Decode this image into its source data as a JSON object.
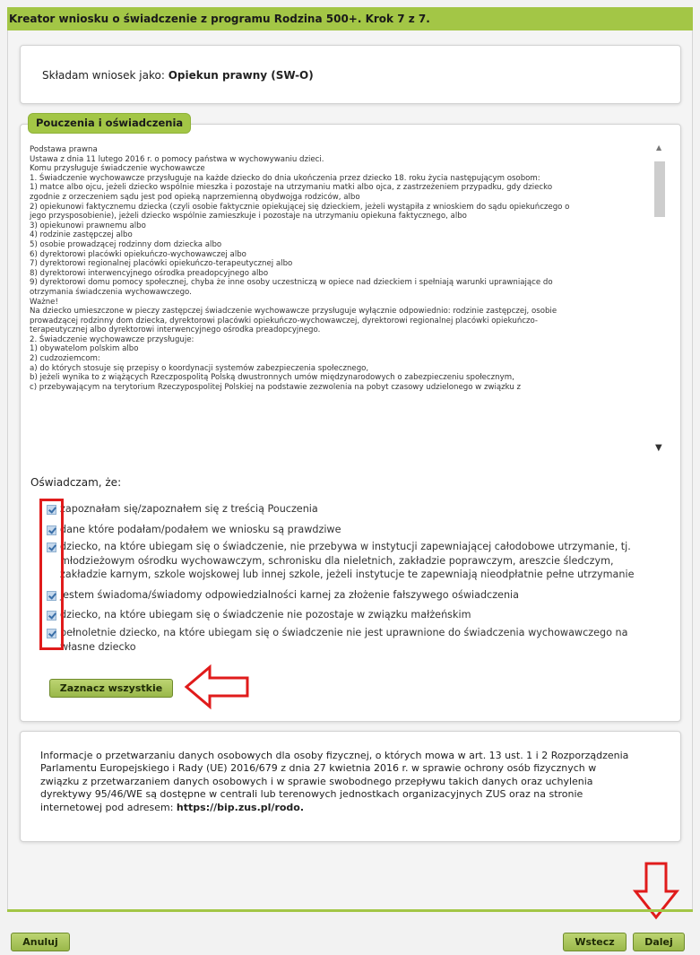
{
  "window": {
    "title": "Kreator wniosku o świadczenie z programu Rodzina 500+. Krok 7 z 7."
  },
  "applicant": {
    "prefix": "Składam wniosek jako:",
    "role": "Opiekun prawny (SW-O)"
  },
  "instructions": {
    "title": "Pouczenia i oświadczenia",
    "lines": [
      "Podstawa prawna",
      "Ustawa z dnia 11 lutego 2016 r. o pomocy państwa w wychowywaniu dzieci.",
      "Komu przysługuje świadczenie wychowawcze",
      "1. Świadczenie wychowawcze przysługuje na każde dziecko do dnia ukończenia przez dziecko 18. roku życia następującym osobom:",
      "1) matce albo ojcu, jeżeli dziecko wspólnie mieszka i pozostaje na utrzymaniu matki albo ojca, z zastrzeżeniem przypadku, gdy dziecko",
      "zgodnie z orzeczeniem sądu jest pod opieką naprzemienną obydwojga rodziców, albo",
      "2) opiekunowi faktycznemu dziecka (czyli osobie faktycznie opiekującej się dzieckiem, jeżeli wystąpiła z wnioskiem do sądu opiekuńczego o",
      "jego przysposobienie), jeżeli dziecko wspólnie zamieszkuje i pozostaje na utrzymaniu opiekuna faktycznego, albo",
      "3) opiekunowi prawnemu albo",
      "4) rodzinie zastępczej albo",
      "5) osobie prowadzącej rodzinny dom dziecka albo",
      "6) dyrektorowi placówki opiekuńczo-wychowawczej albo",
      "7) dyrektorowi regionalnej placówki opiekuńczo-terapeutycznej albo",
      "8) dyrektorowi interwencyjnego ośrodka preadopcyjnego albo",
      "9) dyrektorowi domu pomocy społecznej, chyba że inne osoby uczestniczą w opiece nad dzieckiem i spełniają warunki uprawniające do",
      "otrzymania świadczenia wychowawczego.",
      "Ważne!",
      "Na dziecko umieszczone w pieczy zastępczej świadczenie wychowawcze przysługuje wyłącznie odpowiednio: rodzinie zastępczej, osobie",
      "prowadzącej rodzinny dom dziecka, dyrektorowi placówki opiekuńczo-wychowawczej, dyrektorowi regionalnej placówki opiekuńczo-",
      "terapeutycznej albo dyrektorowi interwencyjnego ośrodka preadopcyjnego.",
      "2. Świadczenie wychowawcze przysługuje:",
      "1) obywatelom polskim albo",
      "2) cudzoziemcom:",
      "a) do których stosuje się przepisy o koordynacji systemów zabezpieczenia społecznego,",
      "b) jeżeli wynika to z wiążących Rzeczpospolitą Polską dwustronnych umów międzynarodowych o zabezpieczeniu społecznym,",
      "c) przebywającym na terytorium Rzeczypospolitej Polskiej na podstawie zezwolenia na pobyt czasowy udzielonego w związku z"
    ]
  },
  "declarations": {
    "heading": "Oświadczam, że:",
    "items": [
      {
        "lines": [
          "zapoznałam się/zapoznałem się z treścią Pouczenia"
        ],
        "checked": true
      },
      {
        "lines": [
          "dane które podałam/podałem we wniosku są prawdziwe"
        ],
        "checked": true
      },
      {
        "lines": [
          "dziecko, na które ubiegam się o świadczenie, nie przebywa w instytucji zapewniającej całodobowe utrzymanie, tj.",
          "młodzieżowym ośrodku wychowawczym, schronisku dla nieletnich, zakładzie poprawczym, areszcie śledczym,",
          "zakładzie karnym, szkole wojskowej lub innej szkole, jeżeli instytucje te zapewniają nieodpłatnie pełne utrzymanie"
        ],
        "checked": true
      },
      {
        "lines": [
          "jestem świadoma/świadomy odpowiedzialności karnej za złożenie fałszywego oświadczenia"
        ],
        "checked": true
      },
      {
        "lines": [
          "dziecko, na które ubiegam się o świadczenie nie pozostaje w związku małżeńskim"
        ],
        "checked": true
      },
      {
        "lines": [
          "pełnoletnie dziecko, na które ubiegam się o świadczenie nie jest uprawnione do świadczenia wychowawczego na",
          "własne dziecko"
        ],
        "checked": true
      }
    ],
    "select_all_label": "Zaznacz wszystkie"
  },
  "privacy": {
    "lines": [
      "Informacje o przetwarzaniu danych osobowych dla osoby fizycznej, o których mowa w art. 13 ust. 1 i 2 Rozporządzenia",
      "Parlamentu Europejskiego i Rady (UE) 2016/679 z dnia 27 kwietnia 2016 r. w sprawie ochrony osób fizycznych w",
      "związku z przetwarzaniem danych osobowych i w sprawie swobodnego przepływu takich danych oraz uchylenia",
      "dyrektywy 95/46/WE są dostępne w centrali lub terenowych jednostkach organizacyjnych ZUS oraz na stronie"
    ],
    "last_prefix": "internetowej pod adresem:",
    "url": "https://bip.zus.pl/rodo."
  },
  "footer": {
    "cancel_label": "Anuluj",
    "back_label": "Wstecz",
    "next_label": "Dalej"
  },
  "colors": {
    "accent": "#a3c646",
    "annotation": "#e01b1b"
  },
  "icons": {
    "scroll_up": "scroll-up-icon",
    "scroll_down": "scroll-down-icon",
    "annotation_arrows": "red-arrow-icon"
  }
}
